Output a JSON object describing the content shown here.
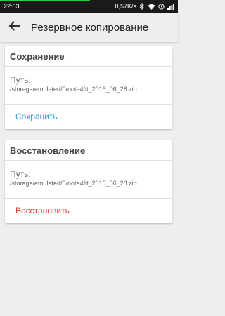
{
  "status_bar": {
    "time": "22:03",
    "network_speed": "0,57K/s",
    "icons": [
      "bluetooth-icon",
      "wifi-icon",
      "alarm-icon",
      "signal-icon"
    ]
  },
  "toolbar": {
    "back_icon": "arrow-back-icon",
    "title": "Резервное копирование"
  },
  "backup_card": {
    "title": "Сохранение",
    "path_label": "Путь:",
    "path": "/storage/emulated/0/note4fit_2015_06_28.zip",
    "action": "Сохранить"
  },
  "restore_card": {
    "title": "Восстановление",
    "path_label": "Путь:",
    "path": "/storage/emulated/0/note4fit_2015_06_28.zip",
    "action": "Восстановить"
  },
  "colors": {
    "accent": "#2aa8d8",
    "danger": "#e53935",
    "background": "#eeeeee"
  }
}
